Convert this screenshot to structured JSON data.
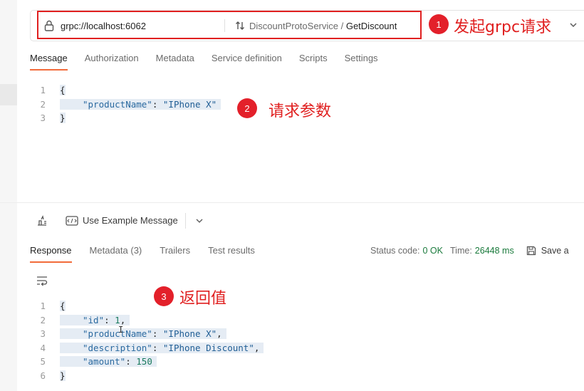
{
  "request": {
    "url": "grpc://localhost:6062",
    "service": "DiscountProtoService",
    "separator": " / ",
    "method": "GetDiscount"
  },
  "request_tabs": [
    "Message",
    "Authorization",
    "Metadata",
    "Service definition",
    "Scripts",
    "Settings"
  ],
  "message_lines": [
    {
      "n": "1",
      "t": "{"
    },
    {
      "n": "2",
      "key": "\"productName\"",
      "colon": ": ",
      "val": "\"IPhone X\"",
      "end": ""
    },
    {
      "n": "3",
      "t": "}"
    }
  ],
  "toolbar": {
    "example_label": "Use Example Message"
  },
  "response_tabs": {
    "response": "Response",
    "metadata": "Metadata (3)",
    "trailers": "Trailers",
    "tests": "Test results"
  },
  "status": {
    "code_label": "Status code:",
    "code_value": "0 OK",
    "time_label": "Time:",
    "time_value": "26448 ms",
    "save_label": "Save a"
  },
  "response_lines": [
    {
      "n": "1",
      "t": "{"
    },
    {
      "n": "2",
      "key": "\"id\"",
      "colon": ": ",
      "val": "1",
      "end": ","
    },
    {
      "n": "3",
      "key": "\"productName\"",
      "colon": ": ",
      "val": "\"IPhone X\"",
      "end": ","
    },
    {
      "n": "4",
      "key": "\"description\"",
      "colon": ": ",
      "val": "\"IPhone Discount\"",
      "end": ","
    },
    {
      "n": "5",
      "key": "\"amount\"",
      "colon": ": ",
      "val": "150",
      "end": ""
    },
    {
      "n": "6",
      "t": "}"
    }
  ],
  "annotations": [
    {
      "num": "1",
      "text": "发起grpc请求"
    },
    {
      "num": "2",
      "text": "请求参数"
    },
    {
      "num": "3",
      "text": "返回值"
    }
  ],
  "colors": {
    "annotation_red": "#e02020",
    "tab_accent": "#f26b3a",
    "status_ok": "#1a7a3c"
  }
}
